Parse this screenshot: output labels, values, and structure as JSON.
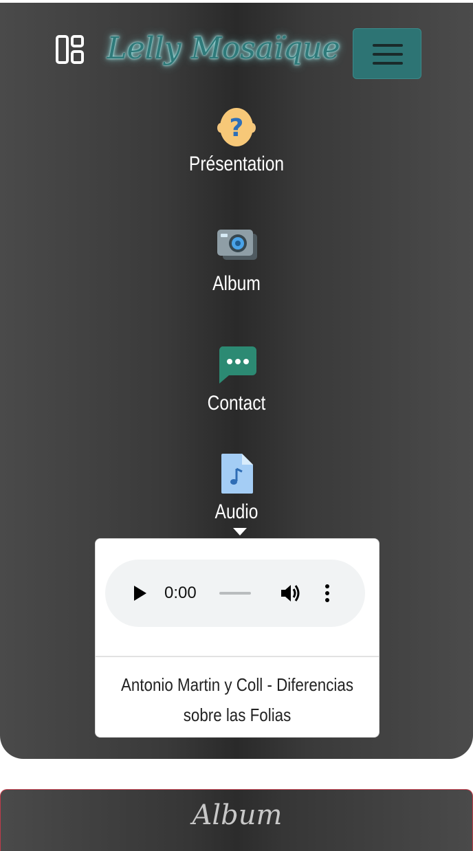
{
  "header": {
    "brand": "Lelly Mosaïque",
    "layout_icon": "layout-dashboard-icon",
    "menu_icon": "hamburger-menu-icon"
  },
  "nav": {
    "items": [
      {
        "label": "Présentation",
        "icon": "question-icon"
      },
      {
        "label": "Album",
        "icon": "camera-icon"
      },
      {
        "label": "Contact",
        "icon": "chat-bubble-icon"
      },
      {
        "label": "Audio",
        "icon": "music-file-icon"
      }
    ]
  },
  "audio_dropdown": {
    "player": {
      "current_time": "0:00"
    },
    "track_title_line1": "Antonio Martin y Coll - Diferencias",
    "track_title_line2": "sobre las Folias"
  },
  "section": {
    "title": "Album"
  },
  "colors": {
    "brand": "#2f7a7a",
    "hamburger_bg": "#2d7474",
    "panel_bg": "#3a3a3a",
    "section_border": "#c03b4a"
  }
}
